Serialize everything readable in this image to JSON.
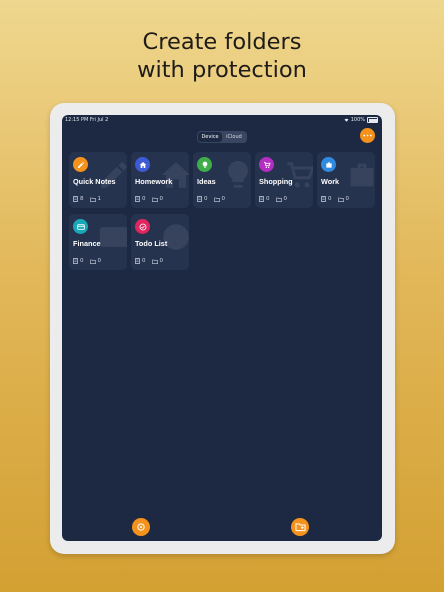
{
  "headline": {
    "line1": "Create folders",
    "line2": "with protection"
  },
  "statusbar": {
    "time_date": "12:15 PM   Fri Jul 2",
    "battery": "100%"
  },
  "segment": {
    "device": "Device",
    "icloud": "iCloud",
    "selected": "Device"
  },
  "folders": [
    {
      "name": "Quick Notes",
      "notes": "8",
      "subfolders": "1",
      "color": "#f4921c",
      "icon": "pencil-icon"
    },
    {
      "name": "Homework",
      "notes": "0",
      "subfolders": "0",
      "color": "#3d5bd6",
      "icon": "home-icon"
    },
    {
      "name": "Ideas",
      "notes": "0",
      "subfolders": "0",
      "color": "#3fae4a",
      "icon": "lightbulb-icon"
    },
    {
      "name": "Shopping",
      "notes": "0",
      "subfolders": "0",
      "color": "#b32fc2",
      "icon": "cart-icon"
    },
    {
      "name": "Work",
      "notes": "0",
      "subfolders": "0",
      "color": "#2f8be0",
      "icon": "briefcase-icon"
    },
    {
      "name": "Finance",
      "notes": "0",
      "subfolders": "0",
      "color": "#1aa7b8",
      "icon": "credit-card-icon"
    },
    {
      "name": "Todo List",
      "notes": "0",
      "subfolders": "0",
      "color": "#e0265e",
      "icon": "check-circle-icon"
    }
  ],
  "colors": {
    "accent": "#f4921c",
    "screen_bg": "#1d2942",
    "card_bg": "#26334f"
  }
}
